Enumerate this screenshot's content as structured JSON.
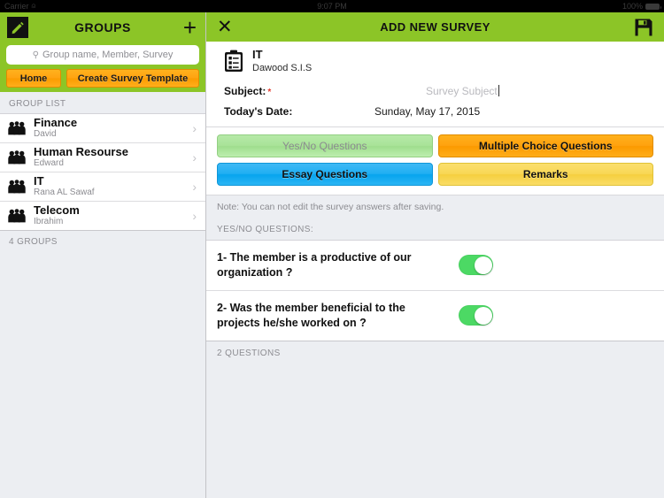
{
  "colors": {
    "brand_green": "#8CC527",
    "orange": "#FFA311",
    "blue": "#1FAEF2",
    "yellow": "#F8D755",
    "light_green": "#A9E398",
    "toggle_on": "#4CD964",
    "required_red": "#E23B2E",
    "panel_bg": "#ECEEF2"
  },
  "statusbar": {
    "carrier": "Carrier",
    "wifi_icon": "wifi-icon",
    "time": "9:07 PM",
    "battery_percent": "100%",
    "battery_icon": "battery-full-icon"
  },
  "sidebar": {
    "nav": {
      "compose_icon": "compose-pencil-icon",
      "title": "GROUPS",
      "add_label": "+"
    },
    "search": {
      "icon": "search-icon",
      "placeholder": "Group name, Member, Survey",
      "value": ""
    },
    "buttons": {
      "home": "Home",
      "create_template": "Create Survey Template"
    },
    "list_header": "GROUP LIST",
    "groups": [
      {
        "icon": "group-people-icon",
        "name": "Finance",
        "owner": "David",
        "chevron": "›"
      },
      {
        "icon": "group-people-icon",
        "name": "Human Resourse",
        "owner": "Edward",
        "chevron": "›"
      },
      {
        "icon": "group-people-icon",
        "name": "IT",
        "owner": "Rana AL Sawaf",
        "chevron": "›"
      },
      {
        "icon": "group-people-icon",
        "name": "Telecom",
        "owner": "Ibrahim",
        "chevron": "›"
      }
    ],
    "list_footer": "4 GROUPS"
  },
  "detail": {
    "nav": {
      "close_icon": "close-x-icon",
      "close_label": "✕",
      "title": "ADD NEW SURVEY",
      "save_icon": "save-floppy-icon"
    },
    "survey": {
      "icon": "clipboard-checklist-icon",
      "group_name": "IT",
      "group_owner": "Dawood S.I.S",
      "subject_label": "Subject:",
      "subject_required_marker": "*",
      "subject_placeholder": "Survey Subject",
      "subject_value": "",
      "date_label": "Today's Date:",
      "date_value": "Sunday, May 17, 2015"
    },
    "tabs": [
      {
        "label": "Yes/No Questions",
        "style": "yesno",
        "selected": true
      },
      {
        "label": "Multiple Choice Questions",
        "style": "mcq",
        "selected": false
      },
      {
        "label": "Essay Questions",
        "style": "essay",
        "selected": false
      },
      {
        "label": "Remarks",
        "style": "remarks",
        "selected": false
      }
    ],
    "note": "Note: You can not edit the survey answers after saving.",
    "section_header": "YES/NO QUESTIONS:",
    "questions": [
      {
        "text": "1- The member is a productive of our organization ?",
        "toggle": "on"
      },
      {
        "text": "2- Was the member beneficial to the projects he/she worked on ?",
        "toggle": "on"
      }
    ],
    "questions_footer": "2 QUESTIONS"
  }
}
